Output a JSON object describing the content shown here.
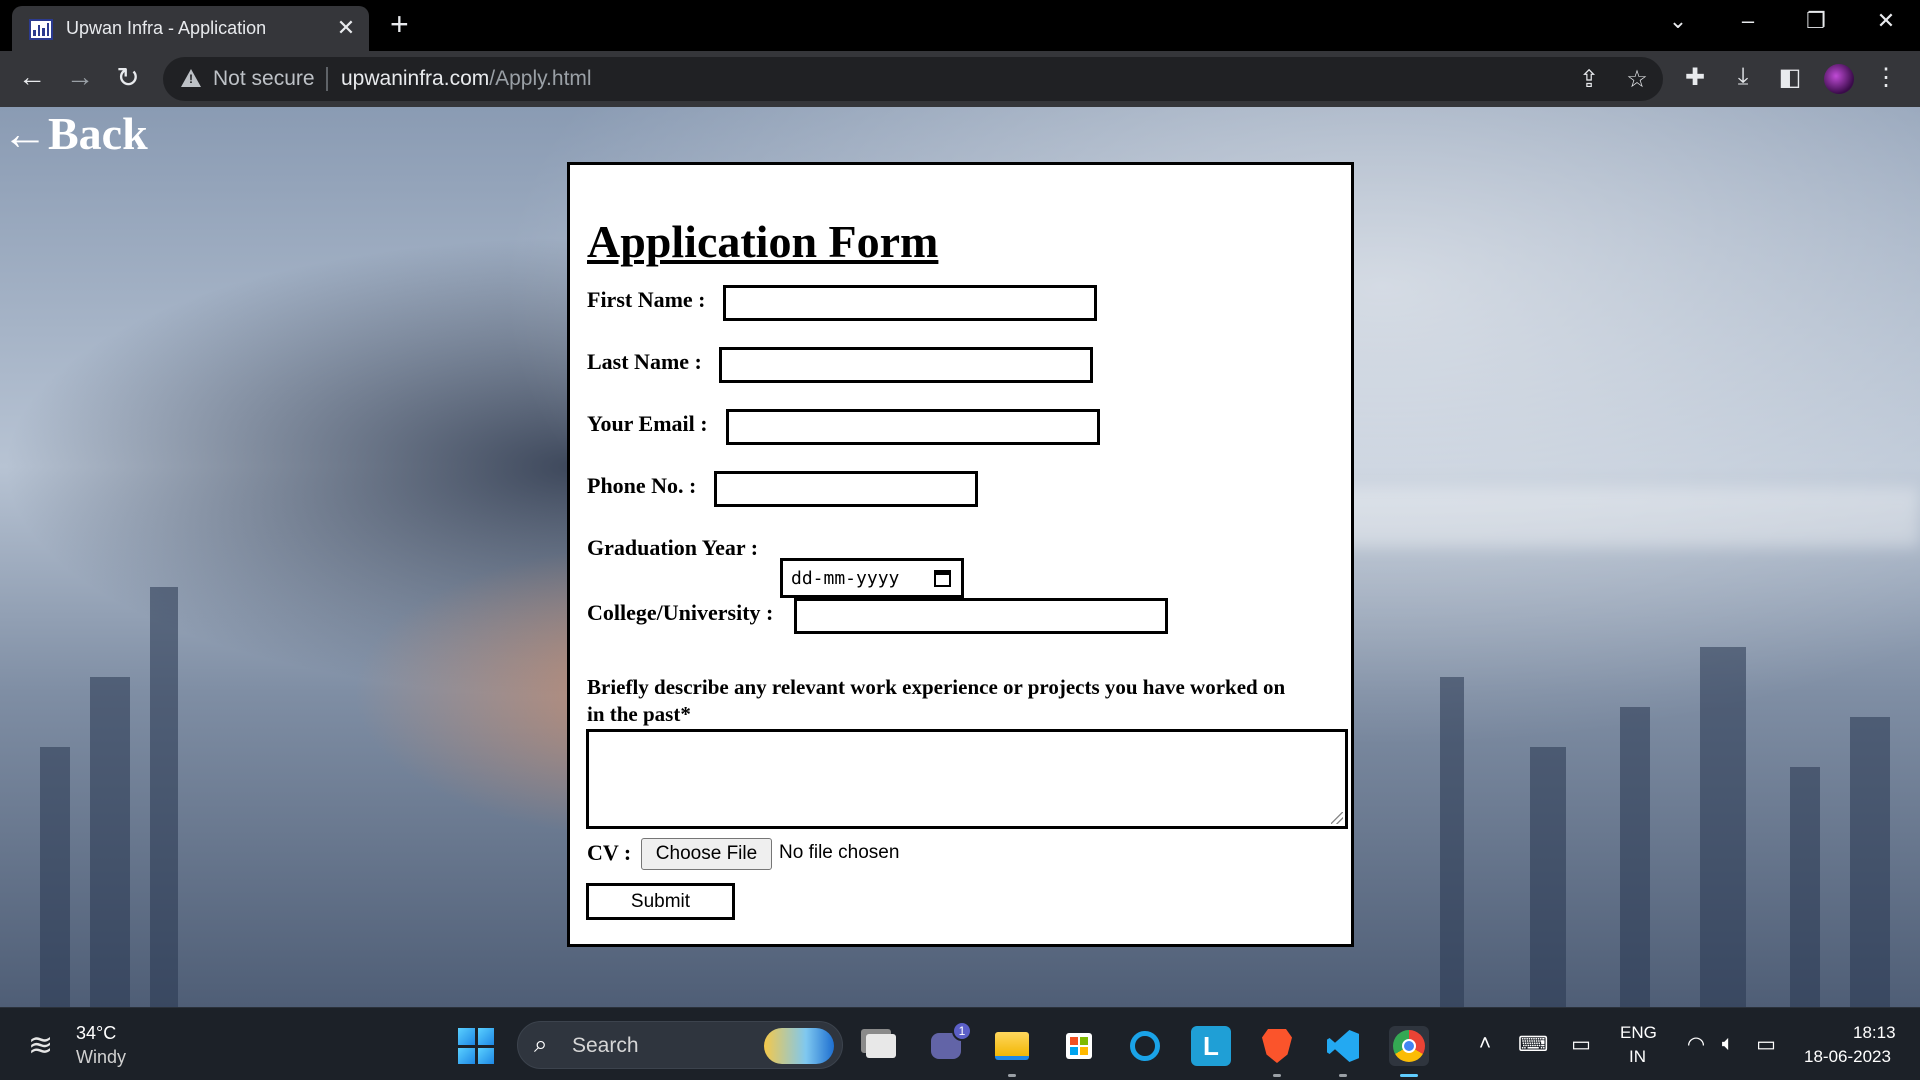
{
  "browser": {
    "tab_title": "Upwan Infra - Application",
    "tab_close": "✕",
    "new_tab": "+",
    "security_label": "Not secure",
    "url_domain": "upwaninfra.com",
    "url_path": "/Apply.html"
  },
  "page": {
    "back_link": "←Back",
    "form_title": "Application Form",
    "fields": {
      "first_name_label": "First Name :",
      "last_name_label": "Last Name :",
      "email_label": "Your Email :",
      "phone_label": "Phone No. :",
      "graduation_label": "Graduation Year :",
      "graduation_placeholder": "dd-mm-yyyy",
      "college_label": "College/University :",
      "description_label": "Briefly describe any relevant work experience or projects you have worked on in the past*",
      "cv_label": "CV :",
      "choose_file": "Choose File",
      "no_file": "No file chosen",
      "submit": "Submit"
    }
  },
  "taskbar": {
    "temperature": "34°C",
    "condition": "Windy",
    "search_label": "Search",
    "chat_badge": "1",
    "lang_line1": "ENG",
    "lang_line2": "IN",
    "time": "18:13",
    "date": "18-06-2023",
    "apps": [
      "task-view",
      "teams-chat",
      "file-explorer",
      "microsoft-store",
      "cortana",
      "l-app",
      "brave",
      "vscode",
      "chrome"
    ]
  },
  "colors": {
    "chrome_dark": "#35363a",
    "taskbar": "#1c2128",
    "form_bg": "#ffffff",
    "accent_blue": "#60cdff"
  }
}
